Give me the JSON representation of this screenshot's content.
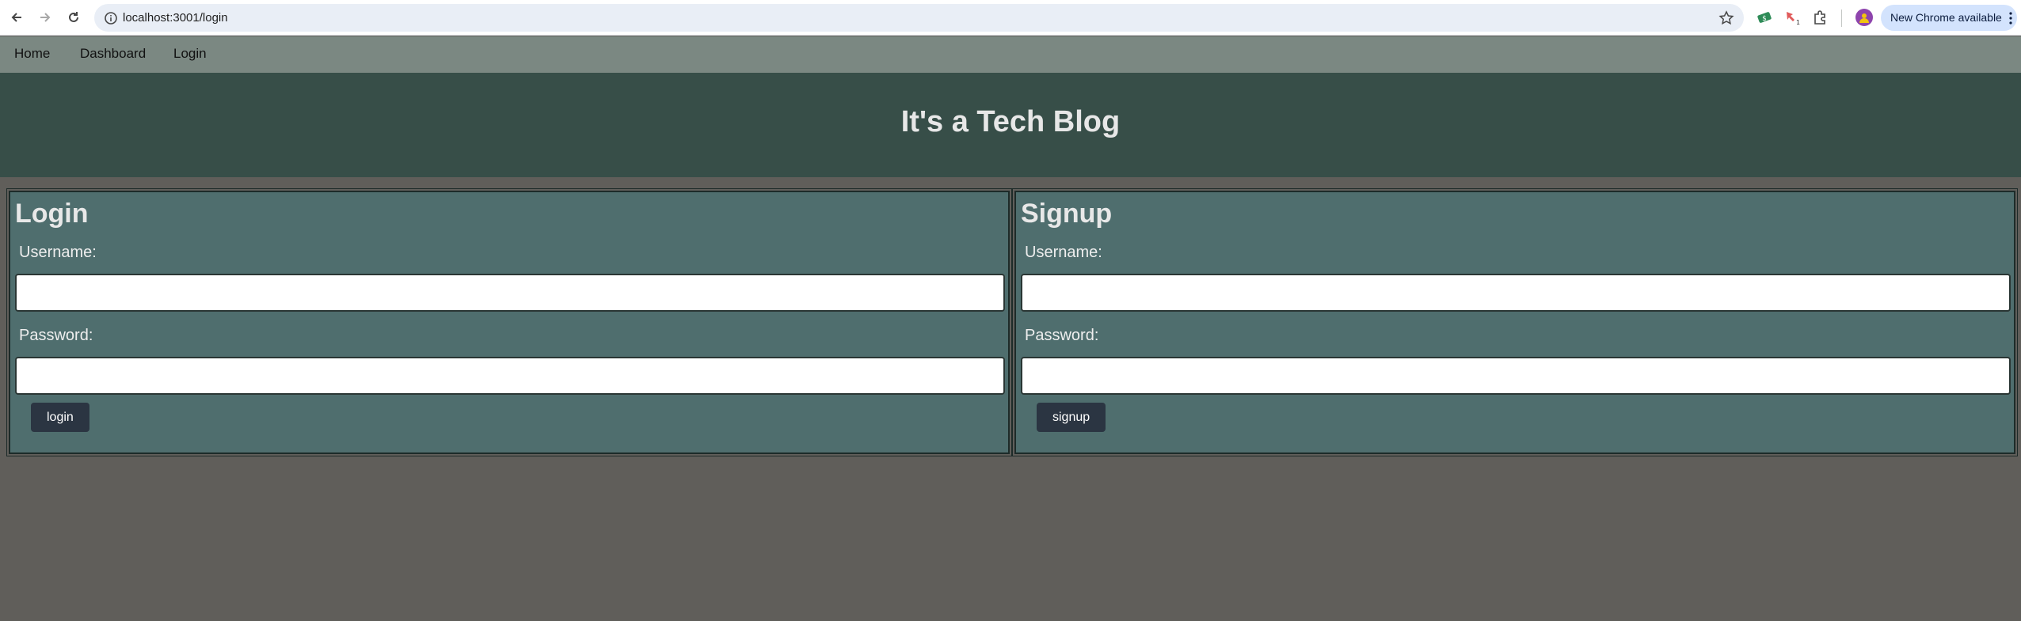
{
  "browser": {
    "url": "localhost:3001/login",
    "update_label": "New Chrome available",
    "extension_badge": "1"
  },
  "nav": {
    "home": "Home",
    "dashboard": "Dashboard",
    "login": "Login"
  },
  "header": {
    "title": "It's a Tech Blog"
  },
  "login_form": {
    "heading": "Login",
    "username_label": "Username:",
    "username_value": "",
    "password_label": "Password:",
    "password_value": "",
    "submit_label": "login"
  },
  "signup_form": {
    "heading": "Signup",
    "username_label": "Username:",
    "username_value": "",
    "password_label": "Password:",
    "password_value": "",
    "submit_label": "signup"
  },
  "colors": {
    "page_bg": "#605e5a",
    "nav_bg": "#7b8882",
    "header_bg": "#374e48",
    "panel_bg": "#4f6e6e",
    "button_bg": "#2b3542"
  }
}
